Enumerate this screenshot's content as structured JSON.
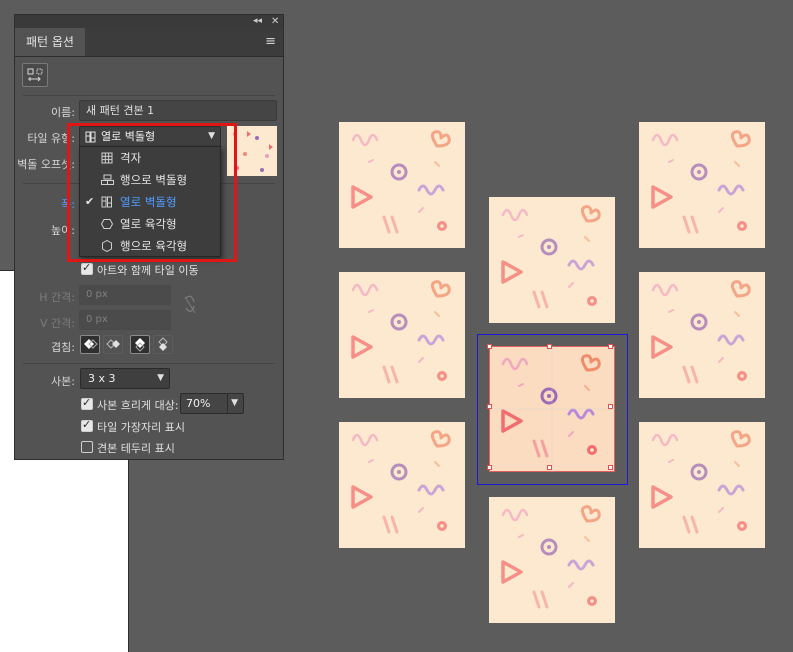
{
  "panel": {
    "title": "패턴 옵션",
    "collapse_icon": "double-chevron-left-icon",
    "close_icon": "close-icon",
    "menu_icon": "hamburger-menu-icon"
  },
  "fields": {
    "name_label": "이름:",
    "name_value": "새 패턴 견본 1",
    "tile_type_label": "타일 유형:",
    "tile_type_value": "열로 벽돌형",
    "brick_offset_label": "벽돌 오프셋:",
    "width_label": "폭:",
    "height_label": "높이:",
    "move_with_art_label": "아트와 함께 타일 이동",
    "h_spacing_label": "H 간격:",
    "h_spacing_value": "0 px",
    "v_spacing_label": "V 간격:",
    "v_spacing_value": "0 px",
    "overlap_label": "겹침:",
    "copies_label": "사본:",
    "copies_value": "3 x 3",
    "dim_copies_label": "사본 흐리게 대상:",
    "dim_copies_value": "70%",
    "show_tile_edge_label": "타일 가장자리 표시",
    "show_swatch_bounds_label": "견본 테두리 표시"
  },
  "checks": {
    "move_with_art": true,
    "dim_copies": true,
    "show_tile_edge": true,
    "show_swatch_bounds": false
  },
  "dropdown": {
    "items": [
      {
        "label": "격자",
        "icon": "grid-icon",
        "selected": false
      },
      {
        "label": "행으로 벽돌형",
        "icon": "brick-by-row-icon",
        "selected": false
      },
      {
        "label": "열로 벽돌형",
        "icon": "brick-by-column-icon",
        "selected": true
      },
      {
        "label": "열로 육각형",
        "icon": "hex-by-column-icon",
        "selected": false
      },
      {
        "label": "행으로 육각형",
        "icon": "hex-by-row-icon",
        "selected": false
      }
    ]
  },
  "colors": {
    "highlight": "#e01515",
    "tile_bg": "#fde9cf",
    "selected_text": "#4f9dff",
    "frame": "#1b1bd6"
  }
}
